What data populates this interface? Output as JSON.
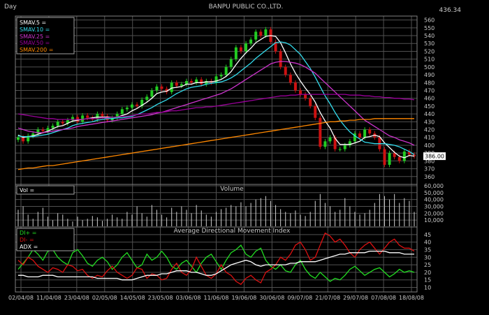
{
  "header": {
    "period": "Day",
    "title": "BANPU PUBLIC CO.,LTD.",
    "top_right_value": "436.34"
  },
  "price_panel": {
    "last_price": "386.00",
    "legend": [
      {
        "label": "SMAV.5 =",
        "color": "#ffffff"
      },
      {
        "label": "SMAV.10 =",
        "color": "#33ddee"
      },
      {
        "label": "SMAV.25 =",
        "color": "#cc33cc"
      },
      {
        "label": "SMAV.50 =",
        "color": "#990099"
      },
      {
        "label": "SMAV.200 =",
        "color": "#ff8800"
      }
    ]
  },
  "volume_panel": {
    "title": "Volume",
    "legend": "Vol ="
  },
  "adx_panel": {
    "title": "Average Directional Movement Index",
    "legend": [
      {
        "label": "DI+ =",
        "color": "#22dd22"
      },
      {
        "label": "DI- =",
        "color": "#dd1111"
      },
      {
        "label": "ADX =",
        "color": "#ffffff"
      }
    ]
  },
  "colors": {
    "background": "#000000",
    "panel_border": "#808080",
    "grid": "#505050",
    "up_candle": "#22cc22",
    "down_candle": "#cc1111",
    "price_marker": "#ffffff"
  },
  "chart_data": [
    {
      "type": "line",
      "title": "BANPU PUBLIC CO.,LTD.",
      "x_tick_labels": [
        "02/04/08",
        "11/04/08",
        "23/04/08",
        "02/05/08",
        "14/05/08",
        "23/05/08",
        "03/06/08",
        "11/06/08",
        "19/06/08",
        "30/06/08",
        "09/07/08",
        "21/07/08",
        "29/07/08",
        "07/08/08",
        "18/08/08"
      ],
      "y_ticks": [
        360,
        370,
        380,
        390,
        400,
        410,
        420,
        430,
        440,
        450,
        460,
        470,
        480,
        490,
        500,
        510,
        520,
        530,
        540,
        550,
        560
      ],
      "ylim": [
        350,
        565
      ],
      "close": [
        410,
        405,
        412,
        415,
        420,
        418,
        422,
        425,
        430,
        428,
        432,
        436,
        430,
        438,
        435,
        433,
        440,
        437,
        432,
        435,
        440,
        446,
        448,
        452,
        450,
        458,
        462,
        470,
        475,
        472,
        468,
        480,
        476,
        478,
        482,
        480,
        484,
        478,
        482,
        480,
        488,
        490,
        500,
        510,
        525,
        520,
        530,
        535,
        545,
        540,
        548,
        532,
        520,
        500,
        490,
        480,
        470,
        465,
        460,
        450,
        435,
        398,
        405,
        410,
        395,
        395,
        400,
        405,
        415,
        410,
        420,
        415,
        410,
        395,
        375,
        390,
        385,
        380,
        392,
        388,
        386
      ],
      "series": [
        {
          "name": "SMAV.5",
          "values": [
            413,
            410,
            411,
            412,
            414,
            416,
            418,
            421,
            424,
            425,
            428,
            431,
            432,
            433,
            434,
            435,
            436,
            436,
            436,
            436,
            436,
            438,
            440,
            444,
            447,
            451,
            455,
            460,
            466,
            468,
            469,
            473,
            474,
            475,
            478,
            478,
            480,
            480,
            481,
            481,
            482,
            484,
            488,
            494,
            503,
            511,
            518,
            524,
            531,
            535,
            539,
            540,
            539,
            531,
            518,
            504,
            492,
            482,
            473,
            465,
            455,
            442,
            431,
            422,
            409,
            401,
            401,
            401,
            403,
            405,
            410,
            411,
            413,
            411,
            403,
            397,
            391,
            386,
            384,
            387,
            386
          ]
        },
        {
          "name": "SMAV.10",
          "values": [
            412,
            411,
            411,
            411,
            412,
            413,
            414,
            416,
            418,
            420,
            422,
            425,
            427,
            428,
            429,
            430,
            432,
            433,
            434,
            434,
            435,
            435,
            436,
            437,
            439,
            442,
            445,
            448,
            452,
            455,
            458,
            462,
            466,
            469,
            472,
            474,
            475,
            476,
            478,
            479,
            480,
            481,
            483,
            486,
            490,
            495,
            500,
            505,
            511,
            516,
            521,
            526,
            531,
            532,
            531,
            528,
            522,
            516,
            507,
            498,
            487,
            475,
            463,
            453,
            442,
            432,
            424,
            417,
            412,
            408,
            404,
            403,
            402,
            402,
            402,
            401,
            400,
            398,
            395,
            392,
            388
          ]
        },
        {
          "name": "SMAV.25",
          "values": [
            422,
            420,
            418,
            417,
            416,
            416,
            417,
            418,
            419,
            420,
            421,
            422,
            424,
            425,
            426,
            427,
            428,
            429,
            430,
            431,
            432,
            433,
            434,
            435,
            436,
            437,
            438,
            439,
            441,
            442,
            444,
            446,
            448,
            450,
            452,
            454,
            456,
            458,
            460,
            462,
            464,
            466,
            469,
            472,
            476,
            480,
            484,
            488,
            492,
            496,
            500,
            504,
            506,
            507,
            507,
            506,
            505,
            503,
            500,
            496,
            492,
            486,
            480,
            474,
            468,
            462,
            456,
            450,
            444,
            438,
            432,
            428,
            424,
            420,
            416,
            412,
            410,
            407,
            405,
            403,
            400
          ]
        },
        {
          "name": "SMAV.50",
          "values": [
            440,
            439,
            438,
            437,
            436,
            435,
            434,
            434,
            433,
            433,
            433,
            433,
            433,
            433,
            434,
            434,
            434,
            435,
            435,
            436,
            436,
            437,
            437,
            438,
            439,
            440,
            440,
            441,
            442,
            442,
            443,
            444,
            444,
            445,
            446,
            447,
            448,
            448,
            449,
            449,
            450,
            451,
            452,
            453,
            454,
            455,
            456,
            457,
            458,
            459,
            460,
            461,
            462,
            463,
            463,
            464,
            464,
            465,
            465,
            465,
            465,
            465,
            465,
            465,
            465,
            465,
            465,
            464,
            464,
            464,
            463,
            463,
            462,
            462,
            461,
            461,
            460,
            460,
            459,
            459,
            458
          ]
        },
        {
          "name": "SMAV.200",
          "values": [
            369,
            370,
            371,
            371,
            372,
            373,
            374,
            374,
            375,
            376,
            377,
            378,
            379,
            380,
            381,
            382,
            383,
            384,
            385,
            386,
            387,
            388,
            389,
            390,
            391,
            392,
            393,
            394,
            395,
            396,
            397,
            398,
            399,
            400,
            401,
            402,
            403,
            404,
            405,
            406,
            407,
            408,
            409,
            410,
            411,
            412,
            413,
            414,
            415,
            416,
            417,
            418,
            419,
            420,
            421,
            422,
            423,
            424,
            425,
            426,
            427,
            428,
            429,
            430,
            430,
            431,
            431,
            432,
            432,
            433,
            433,
            433,
            434,
            434,
            434,
            434,
            434,
            434,
            434,
            434,
            434
          ]
        }
      ]
    },
    {
      "type": "bar",
      "title": "Volume",
      "y_ticks": [
        10000,
        20000,
        30000,
        40000,
        50000,
        60000
      ],
      "y_tick_labels": [
        "10,000",
        "20,000",
        "30,000",
        "40,000",
        "50,000",
        "60,000"
      ],
      "ylim": [
        0,
        62000
      ],
      "values": [
        25000,
        30000,
        18000,
        12000,
        22000,
        28000,
        15000,
        10000,
        20000,
        18000,
        12000,
        8000,
        15000,
        10000,
        12000,
        16000,
        14000,
        9000,
        12000,
        18000,
        14000,
        12000,
        22000,
        18000,
        30000,
        20000,
        15000,
        32000,
        25000,
        18000,
        14000,
        28000,
        22000,
        30000,
        25000,
        20000,
        32000,
        24000,
        18000,
        15000,
        22000,
        26000,
        28000,
        32000,
        30000,
        36000,
        30000,
        35000,
        40000,
        42000,
        45000,
        38000,
        32000,
        26000,
        22000,
        20000,
        24000,
        18000,
        16000,
        22000,
        38000,
        48000,
        35000,
        30000,
        22000,
        25000,
        42000,
        30000,
        22000,
        18000,
        20000,
        25000,
        35000,
        48000,
        45000,
        40000,
        48000,
        35000,
        42000,
        38000,
        22000
      ]
    },
    {
      "type": "line",
      "title": "Average Directional Movement Index",
      "y_ticks": [
        10,
        15,
        20,
        25,
        30,
        35,
        40,
        45
      ],
      "ylim": [
        7,
        50
      ],
      "series": [
        {
          "name": "DI+",
          "values": [
            22,
            26,
            30,
            35,
            32,
            28,
            34,
            35,
            30,
            27,
            25,
            33,
            35,
            31,
            26,
            24,
            28,
            30,
            27,
            22,
            25,
            30,
            33,
            28,
            23,
            25,
            32,
            28,
            30,
            34,
            30,
            24,
            22,
            26,
            28,
            24,
            20,
            26,
            30,
            32,
            27,
            22,
            28,
            33,
            35,
            38,
            32,
            30,
            34,
            36,
            28,
            24,
            22,
            25,
            21,
            20,
            25,
            28,
            22,
            18,
            16,
            20,
            17,
            14,
            16,
            15,
            18,
            22,
            24,
            21,
            18,
            20,
            22,
            23,
            20,
            17,
            19,
            22,
            20,
            21,
            20
          ]
        },
        {
          "name": "DI-",
          "values": [
            28,
            25,
            30,
            28,
            24,
            22,
            20,
            23,
            22,
            20,
            25,
            24,
            21,
            22,
            18,
            16,
            18,
            17,
            21,
            24,
            20,
            18,
            16,
            18,
            23,
            22,
            16,
            19,
            18,
            15,
            16,
            22,
            26,
            20,
            18,
            22,
            30,
            24,
            18,
            16,
            19,
            25,
            20,
            18,
            14,
            12,
            16,
            18,
            15,
            13,
            20,
            22,
            25,
            30,
            28,
            32,
            38,
            40,
            35,
            28,
            30,
            38,
            46,
            44,
            40,
            42,
            38,
            33,
            30,
            35,
            38,
            40,
            36,
            32,
            36,
            40,
            42,
            38,
            36,
            36,
            34
          ]
        },
        {
          "name": "ADX",
          "values": [
            18,
            18,
            17,
            17,
            17,
            18,
            18,
            18,
            17,
            17,
            17,
            17,
            17,
            17,
            17,
            17,
            16,
            16,
            16,
            16,
            16,
            15,
            15,
            15,
            16,
            17,
            18,
            18,
            18,
            19,
            19,
            20,
            21,
            21,
            21,
            20,
            20,
            19,
            18,
            18,
            19,
            21,
            23,
            25,
            26,
            27,
            28,
            27,
            25,
            24,
            25,
            25,
            25,
            25,
            25,
            26,
            26,
            27,
            27,
            27,
            27,
            28,
            29,
            30,
            31,
            32,
            32,
            33,
            33,
            33,
            33,
            34,
            34,
            34,
            34,
            33,
            33,
            33,
            32,
            32,
            32
          ]
        }
      ]
    }
  ]
}
